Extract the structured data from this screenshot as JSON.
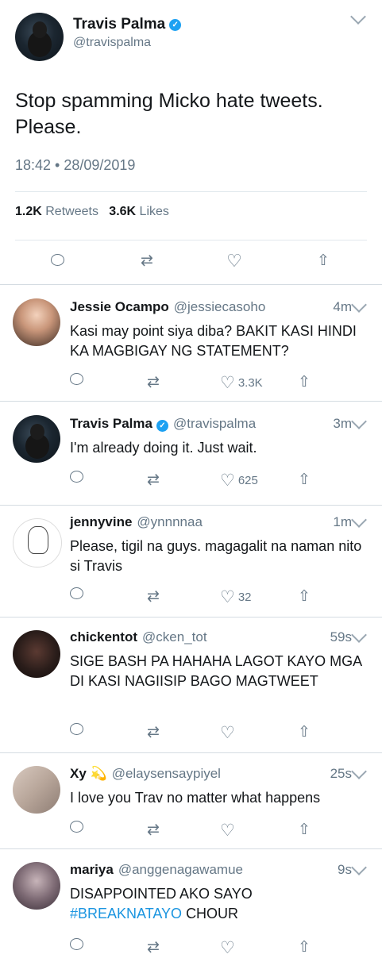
{
  "main_tweet": {
    "name": "Travis Palma",
    "handle": "@travispalma",
    "text": "Stop spamming Micko hate tweets. Please.",
    "timestamp": "18:42 • 28/09/2019",
    "retweets_count": "1.2K",
    "retweets_label": "Retweets",
    "likes_count": "3.6K",
    "likes_label": "Likes"
  },
  "replies": [
    {
      "name": "Jessie Ocampo",
      "handle": "@jessiecasoho",
      "time": "4m",
      "text": "Kasi may point siya diba? BAKIT KASI HINDI KA MAGBIGAY NG STATEMENT?",
      "likes": "3.3K",
      "verified": false
    },
    {
      "name": "Travis Palma",
      "handle": "@travispalma",
      "time": "3m",
      "text": "I'm already doing it. Just wait.",
      "likes": "625",
      "verified": true
    },
    {
      "name": "jennyvine",
      "handle": "@ynnnnaa",
      "time": "1m",
      "text": "Please, tigil na guys. magagalit na naman nito si Travis",
      "likes": "32",
      "verified": false
    },
    {
      "name": "chickentot",
      "handle": "@cken_tot",
      "time": "59s",
      "text": "SIGE BASH PA HAHAHA LAGOT KAYO MGA DI KASI NAGIISIP BAGO MAGTWEET",
      "likes": "",
      "verified": false
    },
    {
      "name": "Xy 💫",
      "handle": "@elaysensaypiyel",
      "time": "25s",
      "text": "I love you Trav no matter what happens",
      "likes": "",
      "verified": false
    },
    {
      "name": "mariya",
      "handle": "@anggenagawamue",
      "time": "9s",
      "text_part1": "DISAPPOINTED AKO SAYO",
      "hashtag": "#BREAKNATAYO",
      "text_part2": "CHOUR",
      "likes": "",
      "verified": false
    }
  ],
  "icons": {
    "reply": "reply-icon",
    "retweet": "retweet-icon",
    "like": "heart-icon",
    "share": "share-icon",
    "verified": "verified-badge-icon",
    "more": "chevron-down-icon"
  },
  "colors": {
    "accent": "#1da1f2",
    "hashtag": "#1b95e0",
    "muted": "#657786"
  }
}
